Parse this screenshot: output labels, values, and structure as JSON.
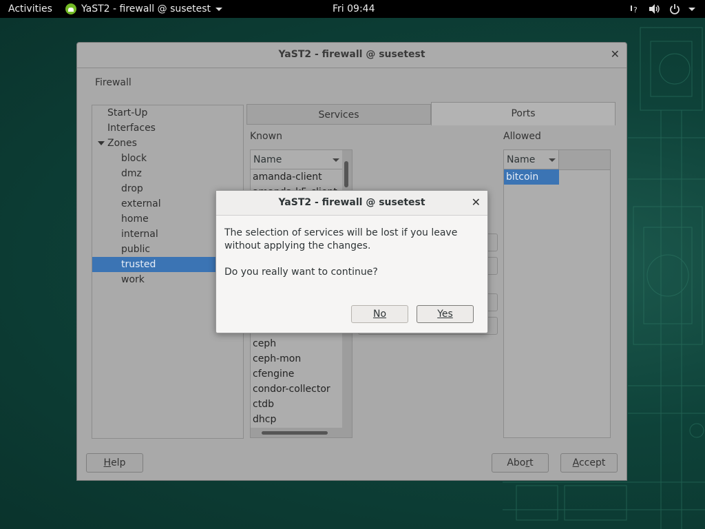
{
  "topbar": {
    "activities": "Activities",
    "app_menu": "YaST2 - firewall @ susetest",
    "clock": "Fri 09:44",
    "tray_icons": [
      "accessibility-icon",
      "volume-icon",
      "power-icon",
      "menu-arrow-icon"
    ]
  },
  "window": {
    "title": "YaST2 - firewall @ susetest",
    "module_title": "Firewall",
    "tree": {
      "items": [
        {
          "label": "Start-Up",
          "level": 0
        },
        {
          "label": "Interfaces",
          "level": 0
        },
        {
          "label": "Zones",
          "level": 0,
          "expanded": true
        },
        {
          "label": "block",
          "level": 1
        },
        {
          "label": "dmz",
          "level": 1
        },
        {
          "label": "drop",
          "level": 1
        },
        {
          "label": "external",
          "level": 1
        },
        {
          "label": "home",
          "level": 1
        },
        {
          "label": "internal",
          "level": 1
        },
        {
          "label": "public",
          "level": 1
        },
        {
          "label": "trusted",
          "level": 1,
          "selected": true
        },
        {
          "label": "work",
          "level": 1
        }
      ]
    },
    "tabs": {
      "services": "Services",
      "ports": "Ports",
      "active": "Ports"
    },
    "known": {
      "label": "Known",
      "column": "Name",
      "rows_top": [
        "amanda-client",
        "amanda-k5-client"
      ],
      "rows_bottom": [
        "ceph",
        "ceph-mon",
        "cfengine",
        "condor-collector",
        "ctdb",
        "dhcp"
      ]
    },
    "allowed": {
      "label": "Allowed",
      "column": "Name",
      "rows": [
        "bitcoin"
      ]
    },
    "buttons": {
      "help": "Help",
      "abort": "Abort",
      "accept": "Accept"
    }
  },
  "dialog": {
    "title": "YaST2 - firewall @ susetest",
    "message": "The selection of services will be lost if you leave without applying the changes.",
    "question": "Do you really want to continue?",
    "no": "No",
    "yes": "Yes"
  },
  "colors": {
    "selection": "#3b74b4",
    "desktop": "#0e4239",
    "topbar": "#000000"
  }
}
